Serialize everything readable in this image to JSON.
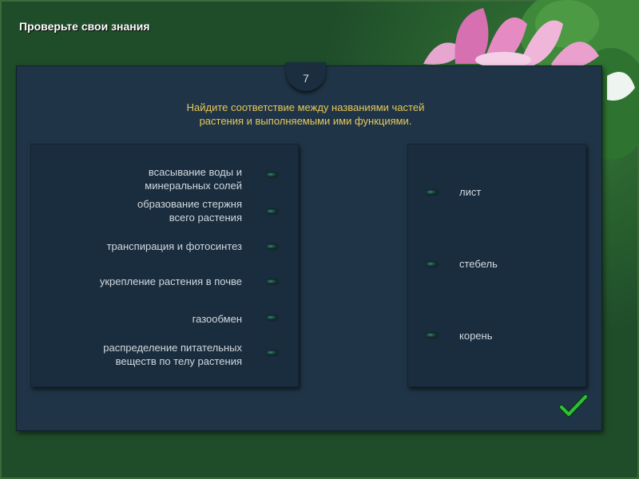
{
  "header": {
    "title": "Проверьте свои знания"
  },
  "task": {
    "step_number": "7",
    "instruction_line1": "Найдите соответствие между названиями частей",
    "instruction_line2": "растения и выполняемыми ими функциями."
  },
  "functions": [
    {
      "line1": "всасывание воды и",
      "line2": "минеральных солей"
    },
    {
      "line1": "образование стержня",
      "line2": "всего растения"
    },
    {
      "line1": "транспирация и фотосинтез",
      "line2": ""
    },
    {
      "line1": "укрепление растения в почве",
      "line2": ""
    },
    {
      "line1": "газообмен",
      "line2": ""
    },
    {
      "line1": "распределение питательных",
      "line2": "веществ по телу растения"
    }
  ],
  "plant_parts": [
    "лист",
    "стебель",
    "корень"
  ],
  "colors": {
    "background": "#1f4d2a",
    "panel": "#1f3547",
    "instruction_text": "#e8c75a",
    "check": "#2fbf3a"
  },
  "icons": {
    "submit": "checkmark-icon",
    "decoration": "lotus-flower-icon"
  }
}
